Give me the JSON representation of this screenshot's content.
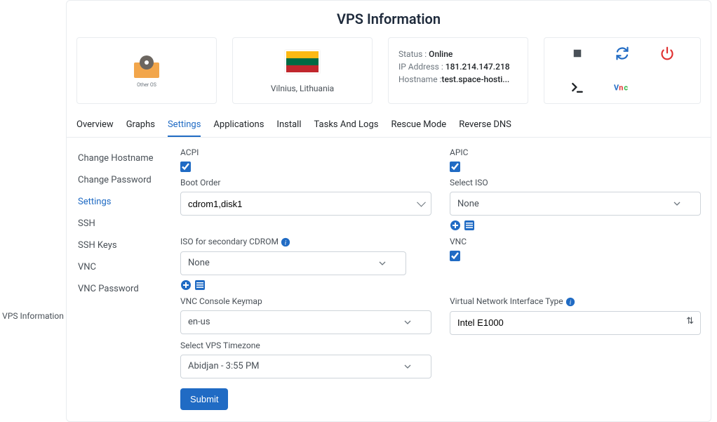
{
  "breadcrumb": "VPS Information",
  "title": "VPS Information",
  "os": {
    "label": "Other OS"
  },
  "location": {
    "name": "Vilnius, Lithuania"
  },
  "status": {
    "status_label": "Status : ",
    "status_value": "Online",
    "ip_label": "IP Address : ",
    "ip_value": "181.214.147.218",
    "host_label": "Hostname :",
    "host_value": "test.space-hosti..."
  },
  "tabs": [
    "Overview",
    "Graphs",
    "Settings",
    "Applications",
    "Install",
    "Tasks And Logs",
    "Rescue Mode",
    "Reverse DNS"
  ],
  "active_tab": "Settings",
  "side": [
    "Change Hostname",
    "Change Password",
    "Settings",
    "SSH",
    "SSH Keys",
    "VNC",
    "VNC Password"
  ],
  "active_side": "Settings",
  "form": {
    "acpi": "ACPI",
    "apic": "APIC",
    "boot_order": "Boot Order",
    "boot_order_val": "cdrom1,disk1",
    "select_iso": "Select ISO",
    "select_iso_val": "None",
    "iso_secondary": "ISO for secondary CDROM",
    "iso_secondary_val": "None",
    "vnc": "VNC",
    "vnc_keymap": "VNC Console Keymap",
    "vnc_keymap_val": "en-us",
    "vnit": "Virtual Network Interface Type",
    "vnit_val": "Intel E1000",
    "timezone": "Select VPS Timezone",
    "timezone_val": "Abidjan - 3:55 PM",
    "submit": "Submit"
  }
}
